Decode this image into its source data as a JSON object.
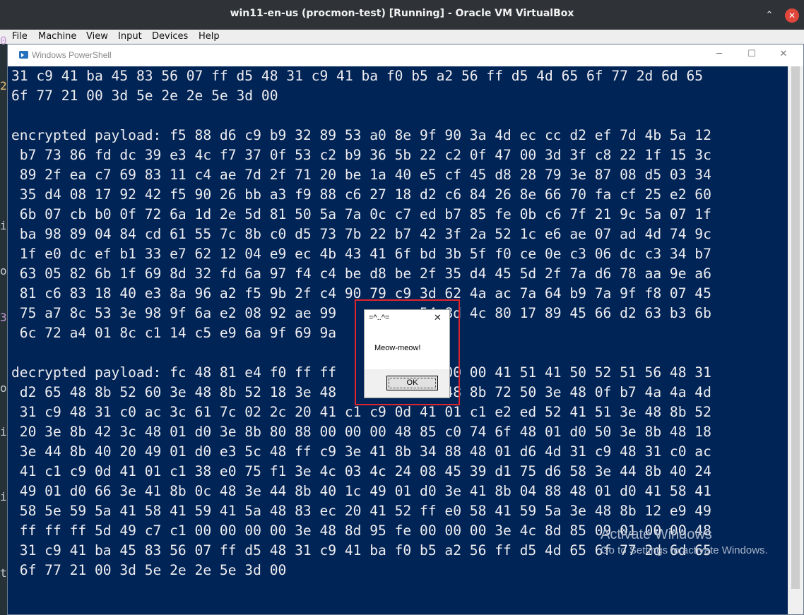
{
  "host_window": {
    "title": "win11-en-us (procmon-test) [Running] - Oracle VM VirtualBox",
    "minimize_glyph": "⌃",
    "maximize_glyph": "⌃",
    "close_glyph": "✕"
  },
  "menubar": {
    "items": [
      "File",
      "Machine",
      "View",
      "Input",
      "Devices",
      "Help"
    ]
  },
  "edge_chars": [
    {
      "ch": "0",
      "color": "#c397d8"
    },
    {
      "ch": "2",
      "color": "#e5c07b"
    },
    {
      "ch": "i",
      "color": "#c8ccd0"
    },
    {
      "ch": "o",
      "color": "#c8ccd0"
    },
    {
      "ch": "3",
      "color": "#c397d8"
    },
    {
      "ch": "o",
      "color": "#c8ccd0"
    },
    {
      "ch": "i",
      "color": "#c8ccd0"
    },
    {
      "ch": "i",
      "color": "#c8ccd0"
    },
    {
      "ch": "t",
      "color": "#c8ccd0"
    }
  ],
  "powershell": {
    "title": "Windows PowerShell",
    "minimize_glyph": "─",
    "maximize_glyph": "☐",
    "close_glyph": "✕",
    "console_lines": [
      "31 c9 41 ba 45 83 56 07 ff d5 48 31 c9 41 ba f0 b5 a2 56 ff d5 4d 65 6f 77 2d 6d 65",
      "6f 77 21 00 3d 5e 2e 2e 5e 3d 00",
      "",
      "encrypted payload: f5 88 d6 c9 b9 32 89 53 a0 8e 9f 90 3a 4d ec cc d2 ef 7d 4b 5a 12",
      " b7 73 86 fd dc 39 e3 4c f7 37 0f 53 c2 b9 36 5b 22 c2 0f 47 00 3d 3f c8 22 1f 15 3c",
      " 89 2f ea c7 69 83 11 c4 ae 7d 2f 71 20 be 1a 40 e5 cf 45 d8 28 79 3e 87 08 d5 03 34",
      " 35 d4 08 17 92 42 f5 90 26 bb a3 f9 88 c6 27 18 d2 c6 84 26 8e 66 70 fa cf 25 e2 60",
      " 6b 07 cb b0 0f 72 6a 1d 2e 5d 81 50 5a 7a 0c c7 ed b7 85 fe 0b c6 7f 21 9c 5a 07 1f",
      " ba 98 89 04 84 cd 61 55 7c 8b c0 d5 73 7b 22 b7 42 3f 2a 52 1c e6 ae 07 ad 4d 74 9c",
      " 1f e0 dc ef b1 33 e7 62 12 04 e9 ec 4b 43 41 6f bd 3b 5f f0 ce 0e c3 06 dc c3 34 b7",
      " 63 05 82 6b 1f 69 8d 32 fd 6a 97 f4 c4 be d8 be 2f 35 d4 45 5d 2f 7a d6 78 aa 9e a6",
      " 81 c6 83 18 40 e3 8a 96 a2 f5 9b 2f c4 90 79 c9 3d 62 4a ac 7a 64 b9 7a 9f f8 07 45",
      " 75 a7 8c 53 3e 98 9f 6a e2 08 92 ae 99          54 8d 4c 80 17 89 45 66 d2 63 b3 6b",
      " 6c 72 a4 01 8c c1 14 c5 e9 6a 9f 69 9a",
      "",
      "decrypted payload: fc 48 81 e4 f0 ff ff          00 00 00 41 51 41 50 52 51 56 48 31",
      " d2 65 48 8b 52 60 3e 48 8b 52 18 3e 48          3e 48 8b 72 50 3e 48 0f b7 4a 4a 4d",
      " 31 c9 48 31 c0 ac 3c 61 7c 02 2c 20 41 c1 c9 0d 41 01 c1 e2 ed 52 41 51 3e 48 8b 52",
      " 20 3e 8b 42 3c 48 01 d0 3e 8b 80 88 00 00 00 48 85 c0 74 6f 48 01 d0 50 3e 8b 48 18",
      " 3e 44 8b 40 20 49 01 d0 e3 5c 48 ff c9 3e 41 8b 34 88 48 01 d6 4d 31 c9 48 31 c0 ac",
      " 41 c1 c9 0d 41 01 c1 38 e0 75 f1 3e 4c 03 4c 24 08 45 39 d1 75 d6 58 3e 44 8b 40 24",
      " 49 01 d0 66 3e 41 8b 0c 48 3e 44 8b 40 1c 49 01 d0 3e 41 8b 04 88 48 01 d0 41 58 41",
      " 58 5e 59 5a 41 58 41 59 41 5a 48 83 ec 20 41 52 ff e0 58 41 59 5a 3e 48 8b 12 e9 49",
      " ff ff ff 5d 49 c7 c1 00 00 00 00 3e 48 8d 95 fe 00 00 00 3e 4c 8d 85 09 01 00 00 48",
      " 31 c9 41 ba 45 83 56 07 ff d5 48 31 c9 41 ba f0 b5 a2 56 ff d5 4d 65 6f 77 2d 6d 65",
      " 6f 77 21 00 3d 5e 2e 2e 5e 3d 00"
    ]
  },
  "watermark": {
    "title": "Activate Windows",
    "subtitle": "Go to Settings to activate Windows."
  },
  "message_box": {
    "title": "=^..^=",
    "close_glyph": "✕",
    "text": "Meow-meow!",
    "ok_label": "OK"
  },
  "colors": {
    "console_bg": "#012456",
    "console_fg": "#eeedf0",
    "highlight": "#e0242c"
  }
}
